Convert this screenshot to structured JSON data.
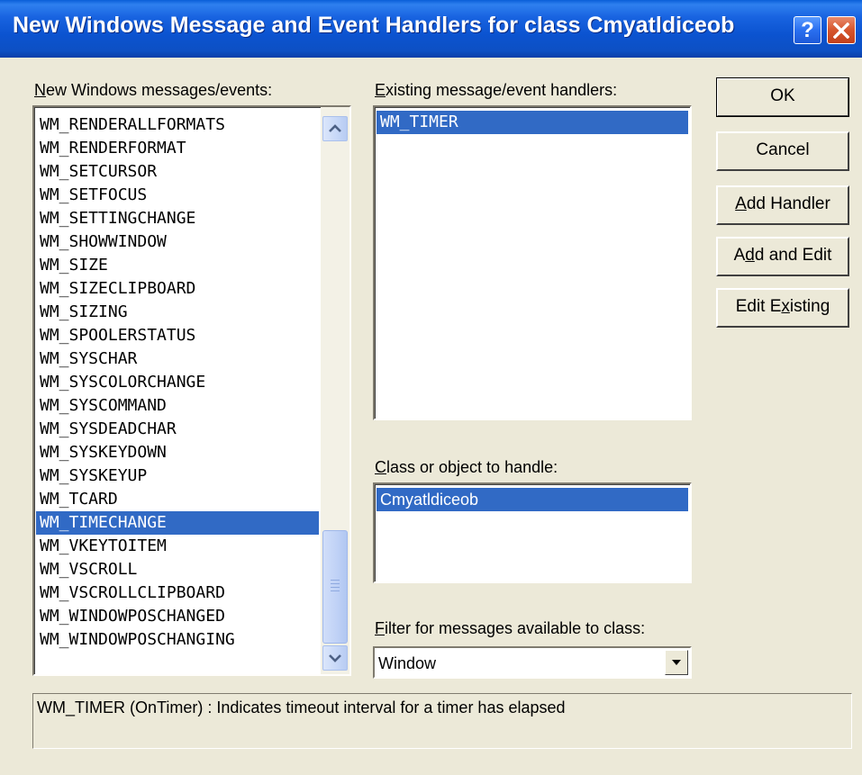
{
  "window": {
    "title": "New Windows Message and Event Handlers for class Cmyatldiceob",
    "help_label": "?",
    "close_icon": "close-x-icon"
  },
  "messages": {
    "label_prefix": "N",
    "label_rest": "ew Windows messages/events:",
    "items": [
      "WM_RENDERALLFORMATS",
      "WM_RENDERFORMAT",
      "WM_SETCURSOR",
      "WM_SETFOCUS",
      "WM_SETTINGCHANGE",
      "WM_SHOWWINDOW",
      "WM_SIZE",
      "WM_SIZECLIPBOARD",
      "WM_SIZING",
      "WM_SPOOLERSTATUS",
      "WM_SYSCHAR",
      "WM_SYSCOLORCHANGE",
      "WM_SYSCOMMAND",
      "WM_SYSDEADCHAR",
      "WM_SYSKEYDOWN",
      "WM_SYSKEYUP",
      "WM_TCARD",
      "WM_TIMECHANGE",
      "WM_VKEYTOITEM",
      "WM_VSCROLL",
      "WM_VSCROLLCLIPBOARD",
      "WM_WINDOWPOSCHANGED",
      "WM_WINDOWPOSCHANGING"
    ],
    "selected_index": 17
  },
  "handlers": {
    "label_prefix": "E",
    "label_rest": "xisting message/event handlers:",
    "items": [
      "WM_TIMER"
    ]
  },
  "class_select": {
    "label_prefix": "C",
    "label_rest": "lass or object to handle:",
    "items": [
      "Cmyatldiceob"
    ]
  },
  "filter": {
    "label_prefix": "F",
    "label_rest": "ilter for messages available to class:",
    "value": "Window"
  },
  "buttons": {
    "ok": "OK",
    "cancel": "Cancel",
    "add_handler_u": "A",
    "add_handler_rest": "dd Handler",
    "add_edit_pre": "A",
    "add_edit_u": "d",
    "add_edit_rest": "d and Edit",
    "edit_existing_pre": "Edit E",
    "edit_existing_u": "x",
    "edit_existing_rest": "isting"
  },
  "description": "WM_TIMER (OnTimer) : Indicates timeout interval for a timer has elapsed",
  "colors": {
    "selection": "#316ac5",
    "dialog_bg": "#ece9d8",
    "titlebar": "#0b53d0"
  }
}
